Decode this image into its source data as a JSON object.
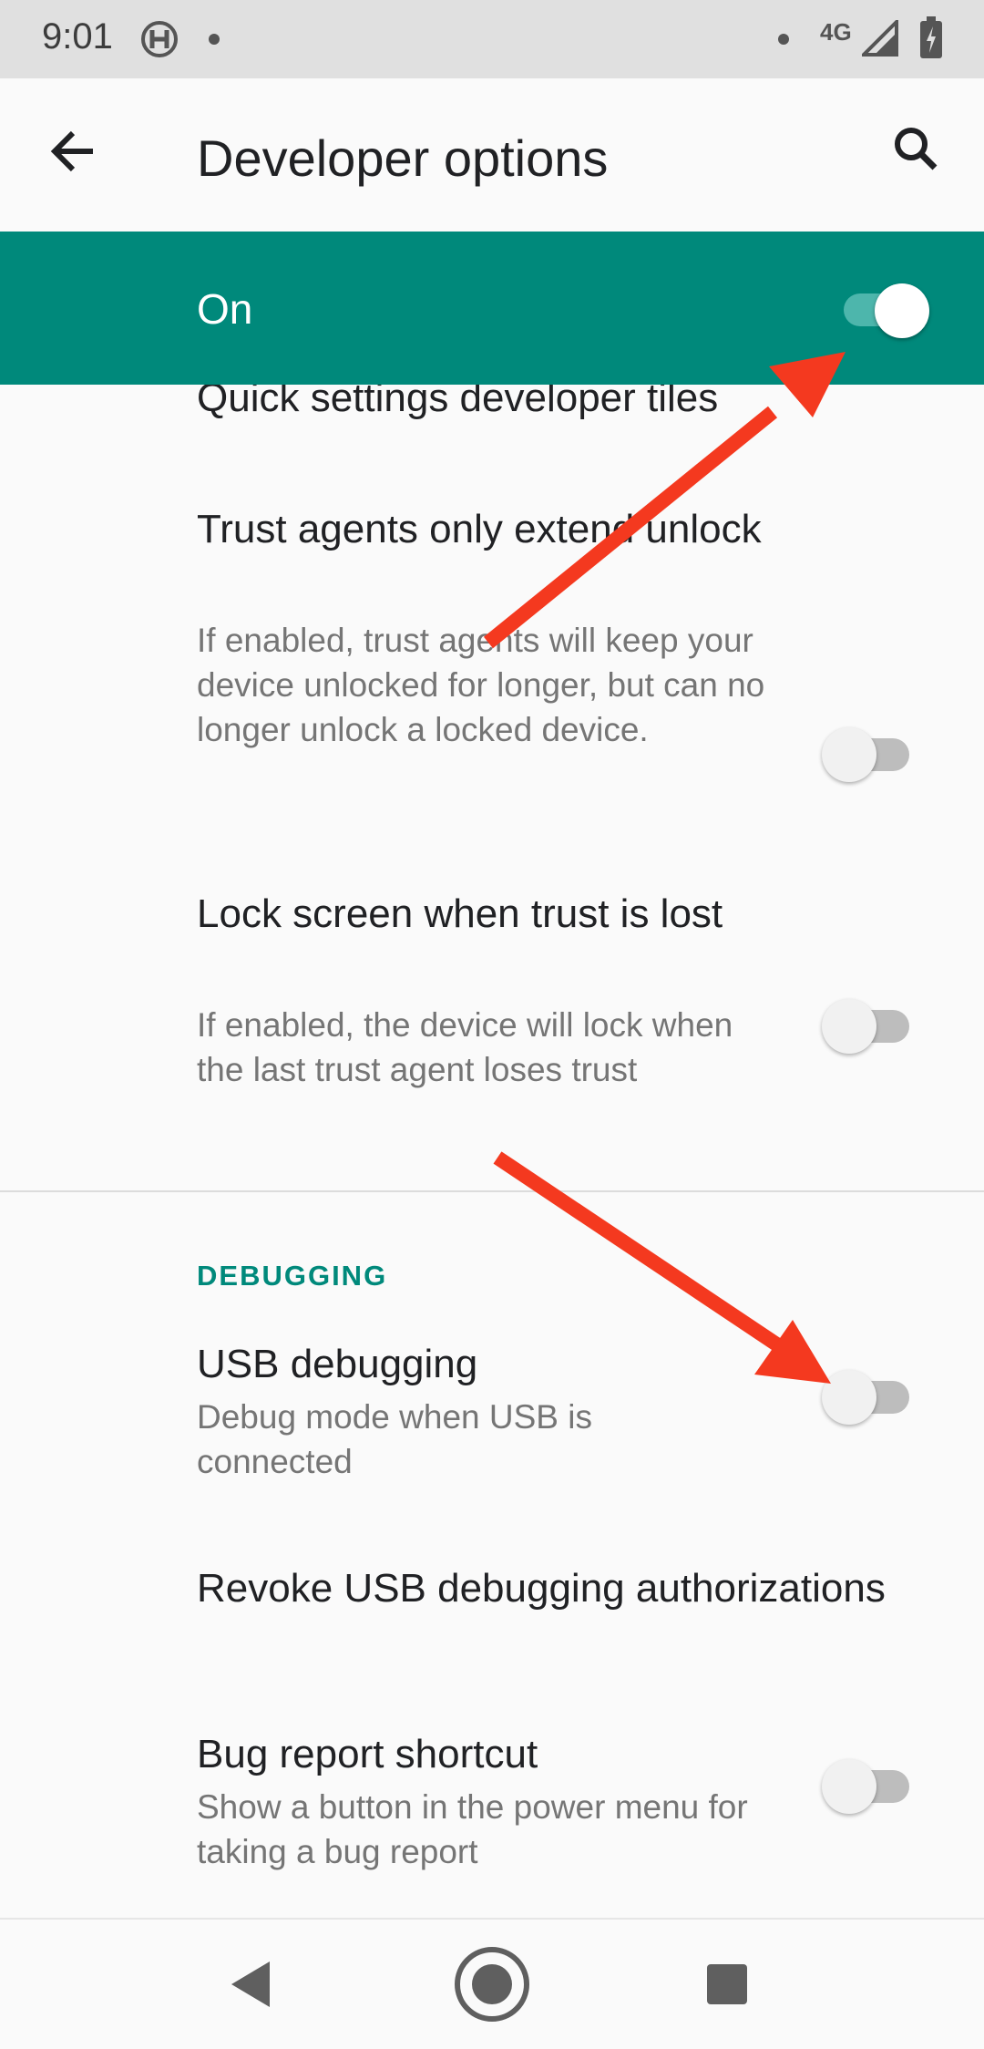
{
  "status_bar": {
    "time": "9:01",
    "network": "4G",
    "icons": [
      "hotspot-icon",
      "notification-dot-icon",
      "signal-icon",
      "battery-charging-icon"
    ]
  },
  "app_bar": {
    "title": "Developer options",
    "back_icon": "arrow-back-icon",
    "search_icon": "search-icon"
  },
  "master_switch": {
    "label": "On",
    "checked": true,
    "bar_color": "#00897b"
  },
  "list": {
    "partial_item_title": "Quick settings developer tiles",
    "items": [
      {
        "title": "Trust agents only extend unlock",
        "summary": "If enabled, trust agents will keep your device unlocked for longer, but can no longer unlock a locked device.",
        "checked": false
      },
      {
        "title": "Lock screen when trust is lost",
        "summary": "If enabled, the device will lock when the last trust agent loses trust",
        "checked": false
      }
    ],
    "category": "DEBUGGING",
    "debug_items": [
      {
        "title": "USB debugging",
        "summary": "Debug mode when USB is connected",
        "checked": false
      },
      {
        "title": "Revoke USB debugging authorizations"
      },
      {
        "title": "Bug report shortcut",
        "summary": "Show a button in the power menu for taking a bug report",
        "checked": false
      }
    ]
  },
  "nav_bar": {
    "icons": [
      "nav-back-icon",
      "nav-home-icon",
      "nav-recents-icon"
    ]
  },
  "colors": {
    "accent": "#00897b",
    "annotation_arrow": "#f4391f",
    "switch_off_track": "#bdbdbd",
    "summary_text": "#757575"
  }
}
